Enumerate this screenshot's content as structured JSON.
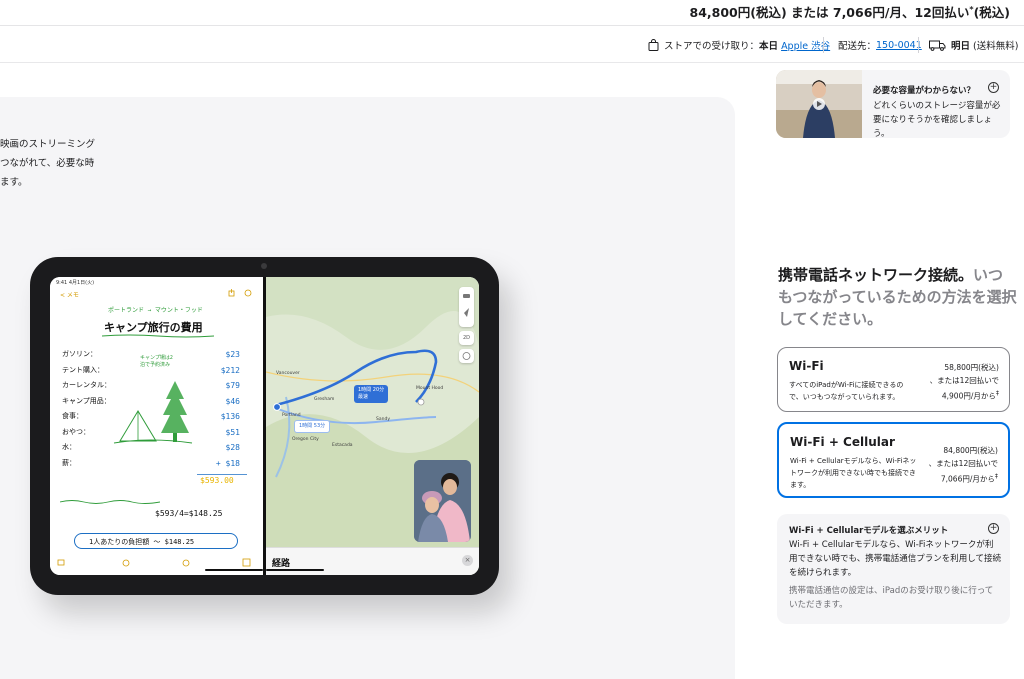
{
  "top_price": {
    "text": "84,800円(税込) または 7,066円/月、12回払い",
    "footnote_mark": "*",
    "suffix": "(税込)"
  },
  "info_bar": {
    "pickup_label": "ストアでの受け取り：",
    "pickup_day": "本日",
    "pickup_store": "Apple 渋谷",
    "delivery_label": "配送先：",
    "postal_code": "150-0041",
    "shipping_day": "明日",
    "shipping_note": "(送料無料)"
  },
  "gallery": {
    "text_lines": [
      "映画のストリーミング",
      "つながれて、必要な時",
      "ます。"
    ],
    "notes": {
      "status_time": "9:41  4月1日(火)",
      "back_label": "< メモ",
      "subtitle": "ポートランド → マウント・フッド",
      "title": "キャンプ旅行の費用",
      "items": [
        {
          "label": "ガソリン：",
          "amount": "$23"
        },
        {
          "label": "テント購入：",
          "amount": "$212"
        },
        {
          "label": "カーレンタル：",
          "amount": "$79"
        },
        {
          "label": "キャンプ用品：",
          "amount": "$46"
        },
        {
          "label": "食事：",
          "amount": "$136"
        },
        {
          "label": "おやつ：",
          "amount": "$51"
        },
        {
          "label": "水：",
          "amount": "$28"
        },
        {
          "label": "薪：",
          "amount": "+ $18"
        }
      ],
      "total": "$593.00",
      "split": "$593/4=$148.25",
      "per_person": "1人あたりの負担額 〜 $148.25",
      "side_note": "キャンプ場は2泊で予約済み"
    },
    "maps": {
      "route_main": "1時間 20分",
      "route_main_sub": "最速",
      "route_alt": "1時間 53分",
      "labels": [
        "Vancouver",
        "Gresham",
        "Portland",
        "Mount Hood",
        "Oregon City",
        "Estacada",
        "Sandy"
      ],
      "view_2d": "2D",
      "sheet_label": "経路"
    }
  },
  "help_card": {
    "title": "必要な容量がわからない？",
    "body": "どれくらいのストレージ容量が必要になりそうかを確認しましょう。"
  },
  "connectivity": {
    "heading_dark": "携帯電話ネットワーク接続。",
    "heading_grey": "いつもつながっているための方法を選択してください。",
    "options": [
      {
        "name": "Wi‑Fi",
        "description": "すべてのiPadがWi‑Fiに接続できるので、いつもつながっていられます。",
        "price_line1": "58,800円(税込)",
        "price_line2": "、または12回払いで",
        "price_line3": "4,900円/月から",
        "footnote": "‡",
        "selected": false
      },
      {
        "name": "Wi‑Fi + Cellular",
        "description": "Wi‑Fi + Cellularモデルなら、Wi‑Fiネットワークが利用できない時でも接続できます。",
        "price_line1": "84,800円(税込)",
        "price_line2": "、または12回払いで",
        "price_line3": "7,066円/月から",
        "footnote": "‡",
        "selected": true
      }
    ]
  },
  "benefit_card": {
    "title": "Wi‑Fi + Cellularモデルを選ぶメリット",
    "body": "Wi‑Fi + Cellularモデルなら、Wi‑Fiネットワークが利用できない時でも、携帯電話通信プランを利用して接続を続けられます。",
    "note": "携帯電話通信の設定は、iPadのお受け取り後に行っていただきます。"
  },
  "colors": {
    "accent_blue": "#0071e3",
    "link_blue": "#0066cc",
    "panel_grey": "#f5f5f7",
    "text_grey": "#86868b"
  }
}
